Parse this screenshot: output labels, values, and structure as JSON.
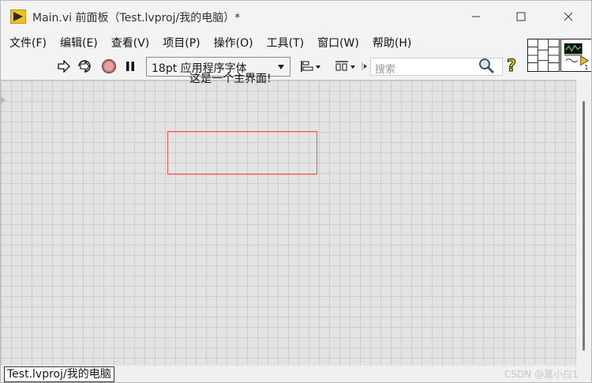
{
  "window": {
    "title": "Main.vi 前面板（Test.lvproj/我的电脑）*",
    "controls": {
      "minimize_icon": "minimize-icon",
      "maximize_icon": "maximize-icon",
      "close_icon": "close-icon"
    }
  },
  "menu": {
    "items": [
      "文件(F)",
      "编辑(E)",
      "查看(V)",
      "项目(P)",
      "操作(O)",
      "工具(T)",
      "窗口(W)",
      "帮助(H)"
    ]
  },
  "toolbar": {
    "font_select_value": "18pt 应用程序字体",
    "search_placeholder": "搜索",
    "help_label": "?"
  },
  "canvas": {
    "main_label": "这是一个主界面!"
  },
  "status": {
    "path": "Test.lvproj/我的电脑",
    "watermark": "CSDN @葛小白1"
  },
  "colors": {
    "accent_red": "#e05a5a",
    "stop_button": "#d36a6a",
    "help_yellow": "#e7c000",
    "app_icon_yellow": "#f0c020"
  }
}
